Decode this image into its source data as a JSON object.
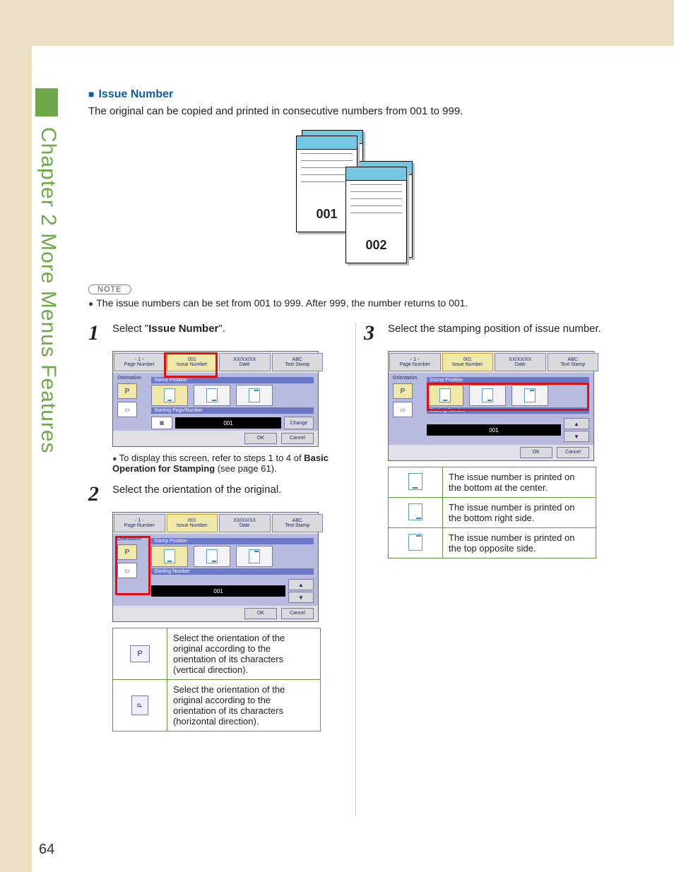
{
  "chapter_label": "Chapter 2   More Menus Features",
  "heading": "Issue Number",
  "intro": "The original can be copied and printed in consecutive numbers from 001 to 999.",
  "fig": {
    "doc1": "001",
    "doc2": "002"
  },
  "note_label": "NOTE",
  "note_text": "The issue numbers can be set from 001 to 999. After 999, the number returns to 001.",
  "steps": {
    "s1": {
      "num": "1",
      "text_pre": "Select \"",
      "text_bold": "Issue Number",
      "text_post": "\"."
    },
    "s1_sub": {
      "pre": "To display this screen, refer to steps 1 to 4 of ",
      "bold": "Basic Operation for Stamping",
      "post": " (see page 61)."
    },
    "s2": {
      "num": "2",
      "text": "Select the orientation of the original."
    },
    "s3": {
      "num": "3",
      "text": "Select the stamping position of issue number."
    }
  },
  "ui": {
    "tabs": {
      "page_number_icon": "- 1 -",
      "page_number": "Page Number",
      "issue_number_icon": "001",
      "issue_number": "Issue Number",
      "date_icon": "XX/XX/XX",
      "date": "Date",
      "text_stamp_icon": "ABC",
      "text_stamp": "Text Stamp"
    },
    "orientation_label": "Orientation",
    "stamp_position_label": "Stamp Position",
    "starting_page_number_label": "Starting Page/Number",
    "starting_number_label": "Starting Number",
    "number_display": "001",
    "change_btn": "Change",
    "ok_btn": "OK",
    "cancel_btn": "Cancel"
  },
  "orient_table": [
    {
      "icon": "P",
      "caption": "Select the orientation of the original according to the orientation of its characters (vertical direction)."
    },
    {
      "icon": "P",
      "caption": "Select the orientation of the original according to the orientation of its characters (horizontal direction)."
    }
  ],
  "pos_table": [
    {
      "caption": "The issue number is printed on the bottom at the center."
    },
    {
      "caption": "The issue number is printed on the bottom right side."
    },
    {
      "caption": "The issue number is printed on the top opposite side."
    }
  ],
  "page_number": "64"
}
